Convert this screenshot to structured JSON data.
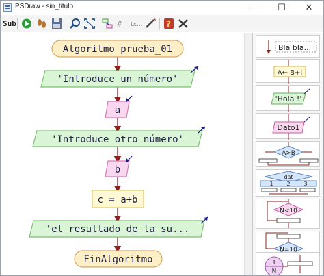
{
  "window": {
    "title": "PSDraw - sin_titulo",
    "minimize": "—",
    "maximize": "☐",
    "close": "✕"
  },
  "toolbar": {
    "sub_label": "Sub"
  },
  "flowchart": {
    "start": "Algoritmo prueba_01",
    "output1": "'Introduce un número'",
    "input1": "a",
    "output2": "'Introduce otro número'",
    "input2": "b",
    "assign": "c = a+b",
    "output3": "'el resultado de la su...",
    "end": "FinAlgoritmo"
  },
  "palette": {
    "comment": "Bla bla...",
    "assign": "A← B+i",
    "output": "'Hola !'",
    "input": "Dato1",
    "if_cond": "A>B",
    "switch_label": "dat",
    "switch_cases": [
      "1",
      "2",
      "3"
    ],
    "while_cond": "N<10",
    "repeat_cond": "N=10",
    "for_a": "1",
    "for_b": "N"
  },
  "colors": {
    "terminal_fill": "#fcefc5",
    "terminal_stroke": "#d9a869",
    "output_fill": "#d9f5d5",
    "output_stroke": "#7cbf72",
    "input_fill": "#f9d8ef",
    "input_stroke": "#d97ab8",
    "assign_fill": "#fff9d6",
    "assign_stroke": "#e0c86c",
    "arrow": "#8b2020",
    "text": "#222244",
    "accent_blue": "#1a1a8a"
  }
}
